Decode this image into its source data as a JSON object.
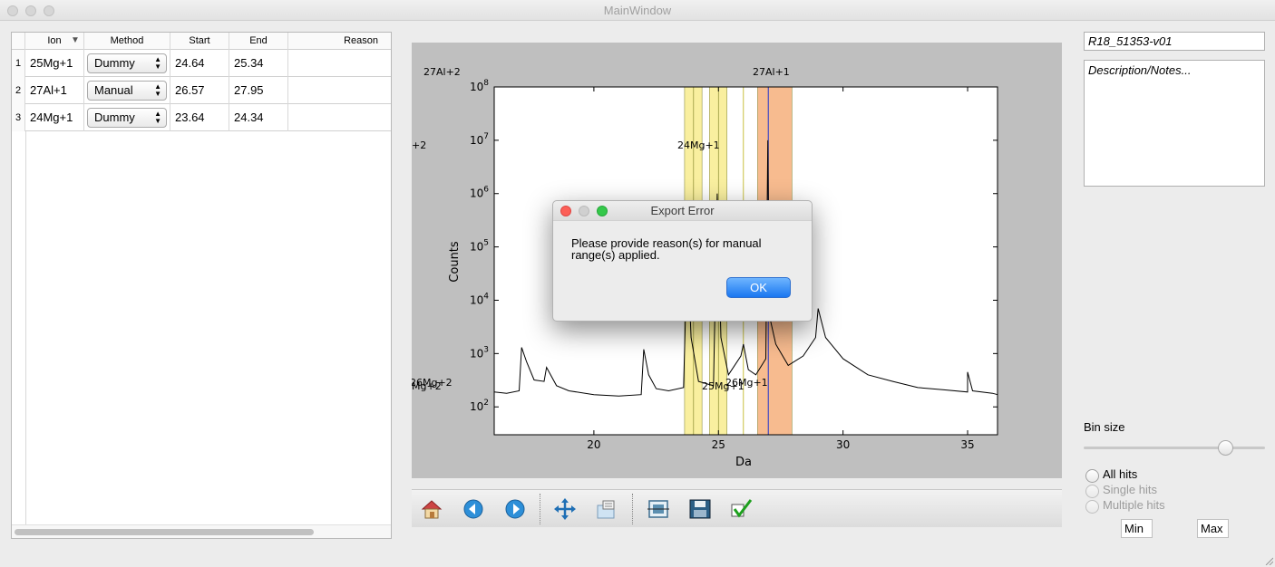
{
  "window": {
    "title": "MainWindow"
  },
  "table": {
    "headers": {
      "ion": "Ion",
      "method": "Method",
      "start": "Start",
      "end": "End",
      "reason": "Reason"
    },
    "rows": [
      {
        "num": "1",
        "ion": "25Mg+1",
        "method": "Dummy",
        "start": "24.64",
        "end": "25.34",
        "reason": ""
      },
      {
        "num": "2",
        "ion": "27Al+1",
        "method": "Manual",
        "start": "26.57",
        "end": "27.95",
        "reason": ""
      },
      {
        "num": "3",
        "ion": "24Mg+1",
        "method": "Dummy",
        "start": "23.64",
        "end": "24.34",
        "reason": ""
      }
    ]
  },
  "plot": {
    "xlabel": "Da",
    "ylabel": "Counts",
    "x_ticks": [
      "20",
      "25",
      "30",
      "35"
    ],
    "y_ticks": [
      "2",
      "3",
      "4",
      "5",
      "6",
      "7",
      "8"
    ],
    "y_tick_base": "10",
    "annotations": {
      "al2_top": "27Al+2",
      "al1_top": "27Al+1",
      "mg24": "24Mg+1",
      "left_2": "+2",
      "mg2_left": "26Mg+2",
      "mg2_left_over": "Mg+2",
      "mg25": "25Mg+1",
      "mg26": "26Mg+1"
    }
  },
  "chart_data": {
    "type": "line",
    "title": "",
    "xlabel": "Da",
    "ylabel": "Counts",
    "xlim": [
      16,
      36.2
    ],
    "ylim": [
      30,
      100000000
    ],
    "y_scale": "log",
    "ranges": [
      {
        "ion": "24Mg+1",
        "start": 23.64,
        "end": 24.34,
        "color": "#f9ef9a"
      },
      {
        "ion": "25Mg+1",
        "start": 24.64,
        "end": 25.34,
        "color": "#f9ef9a"
      },
      {
        "ion": "27Al+1",
        "start": 26.57,
        "end": 27.95,
        "color": "#f7b88a"
      }
    ],
    "spectrum": {
      "x": [
        16,
        16.5,
        17,
        17.1,
        17.3,
        17.6,
        18,
        18.1,
        18.5,
        19,
        20,
        21,
        21.9,
        22,
        22.2,
        22.5,
        23,
        23.6,
        23.75,
        23.9,
        24.2,
        24.8,
        24.95,
        25.1,
        25.4,
        25.9,
        26,
        26.2,
        26.5,
        26.9,
        26.98,
        27.05,
        27.3,
        27.8,
        28.4,
        28.9,
        29,
        29.3,
        30,
        31,
        32,
        33,
        34,
        35,
        35,
        35.2,
        36,
        36.2
      ],
      "y": [
        190,
        180,
        200,
        1300,
        700,
        320,
        300,
        550,
        250,
        200,
        170,
        160,
        170,
        1200,
        400,
        220,
        200,
        230,
        100000,
        2000,
        300,
        250,
        1000000,
        2000,
        400,
        900,
        1500,
        500,
        400,
        800,
        10000000,
        5000,
        1500,
        600,
        900,
        2000,
        7000,
        2000,
        800,
        400,
        300,
        230,
        210,
        190,
        450,
        200,
        180,
        170
      ]
    }
  },
  "toolbar": {
    "icons": [
      "home-icon",
      "back-icon",
      "forward-icon",
      "pan-icon",
      "zoom-icon",
      "configure-subplots-icon",
      "save-icon",
      "apply-check-icon"
    ]
  },
  "right": {
    "id_value": "R18_51353-v01",
    "notes_placeholder": "Description/Notes...",
    "bin_size_label": "Bin size",
    "bin_size_level": 0.78,
    "radio": {
      "all": "All hits",
      "single": "Single hits",
      "multiple": "Multiple hits"
    },
    "min_label": "Min",
    "max_label": "Max"
  },
  "dialog": {
    "title": "Export Error",
    "message": "Please provide reason(s) for manual range(s) applied.",
    "ok": "OK"
  },
  "colors": {
    "yellow_range": "#f9ef9a",
    "orange_range": "#f7b88a",
    "accent_button": "#1a76f0"
  }
}
